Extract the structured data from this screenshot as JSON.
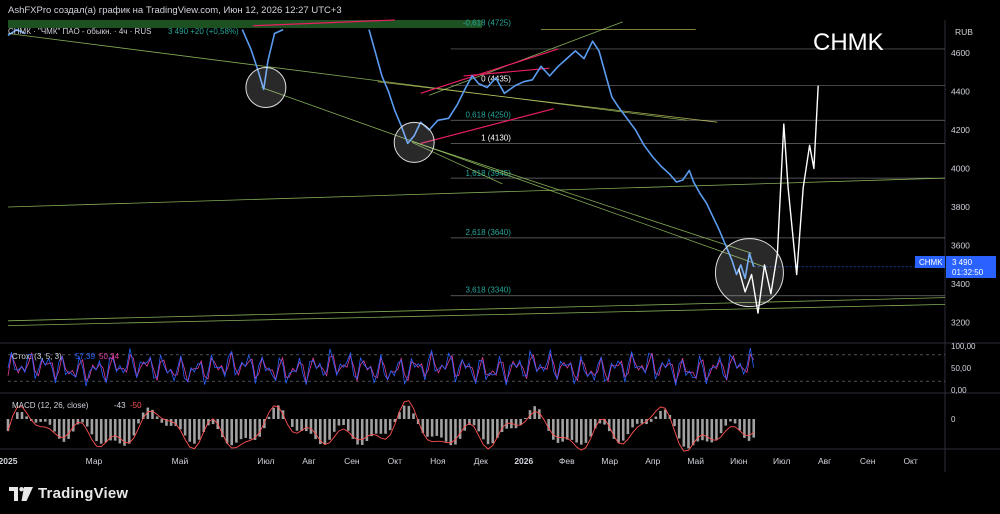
{
  "header": {
    "attribution": "AshFXPro создал(а) график на TradingView.com, Июн 12, 2026 12:27 UTC+3"
  },
  "symbol_bar": {
    "text": "СНМК · \"ЧМК\" ПАО - обыкн. · 4ч · RUS",
    "last_values": "3 490 +20 (+0,58%)"
  },
  "ticker_watermark": "CHMK",
  "currency": "RUB",
  "price_tag": {
    "symbol": "CHMK",
    "price": "3 490",
    "countdown": "01:32:50",
    "color": "#2962ff"
  },
  "fib_labels": [
    {
      "label": "-0,618 (4725)",
      "value": 4725
    },
    {
      "label": "0 (4435)",
      "value": 4435
    },
    {
      "label": "0,618 (4250)",
      "value": 4250
    },
    {
      "label": "1 (4130)",
      "value": 4130
    },
    {
      "label": "1,618 (3945)",
      "value": 3945
    },
    {
      "label": "2,618 (3640)",
      "value": 3640
    },
    {
      "label": "3,618 (3340)",
      "value": 3340
    }
  ],
  "oscillators": {
    "stoch_title": "Стох. (3, 5, 3)",
    "stoch_k": "57,39",
    "stoch_d": "50,34",
    "stoch_axis": [
      "100,00",
      "50,00",
      "0,00"
    ],
    "macd_title": "MACD (12, 26, close)",
    "macd_v1": "-43",
    "macd_v2": "-50",
    "macd_axis": [
      "0"
    ]
  },
  "branding": {
    "logo_text": "TradingView"
  },
  "colors": {
    "price_line": "#5b9cf0",
    "stoch_k": "#2962ff",
    "stoch_d": "#e040a0",
    "macd_line": "#ff5252",
    "macd_hist": "#bdbdbd",
    "fib_label": "#26a69a",
    "trendline": "#9ccc65",
    "channel": "#e91e63",
    "top_band": "#2e7d32"
  },
  "chart_data": {
    "type": "line",
    "title": "СНМК · \"ЧМК\" ПАО - обыкн. · 4ч · RUS",
    "ylabel": "RUB",
    "ylim": [
      3100,
      4770
    ],
    "y_ticks": [
      3200,
      3400,
      3600,
      3800,
      4000,
      4200,
      4400,
      4600
    ],
    "x_ticks": [
      "2025",
      "Мар",
      "Май",
      "Июл",
      "Авг",
      "Сен",
      "Окт",
      "Ноя",
      "Дек",
      "2026",
      "Фев",
      "Мар",
      "Апр",
      "Май",
      "Июн",
      "Июл",
      "Авг",
      "Сен",
      "Окт"
    ],
    "x_tick_month_index": [
      0,
      2,
      4,
      6,
      7,
      8,
      9,
      10,
      11,
      12,
      13,
      14,
      15,
      16,
      17,
      18,
      19,
      20,
      21
    ],
    "x_range_months": [
      0,
      21.8
    ],
    "series": [
      {
        "name": "CHMK",
        "points": [
          [
            0.0,
            4690
          ],
          [
            0.2,
            4720
          ],
          [
            0.4,
            4700
          ],
          [
            5.45,
            4720
          ],
          [
            5.65,
            4620
          ],
          [
            5.8,
            4520
          ],
          [
            5.95,
            4410
          ],
          [
            6.05,
            4560
          ],
          [
            6.2,
            4700
          ],
          [
            6.4,
            4720
          ],
          [
            8.4,
            4720
          ],
          [
            8.55,
            4600
          ],
          [
            8.7,
            4480
          ],
          [
            8.85,
            4400
          ],
          [
            9.0,
            4300
          ],
          [
            9.15,
            4220
          ],
          [
            9.3,
            4130
          ],
          [
            9.45,
            4170
          ],
          [
            9.6,
            4240
          ],
          [
            9.8,
            4200
          ],
          [
            10.0,
            4250
          ],
          [
            10.25,
            4260
          ],
          [
            10.45,
            4330
          ],
          [
            10.65,
            4420
          ],
          [
            10.8,
            4480
          ],
          [
            10.95,
            4440
          ],
          [
            11.15,
            4420
          ],
          [
            11.35,
            4470
          ],
          [
            11.55,
            4390
          ],
          [
            11.8,
            4430
          ],
          [
            12.0,
            4450
          ],
          [
            12.2,
            4460
          ],
          [
            12.4,
            4530
          ],
          [
            12.6,
            4480
          ],
          [
            12.8,
            4530
          ],
          [
            13.0,
            4570
          ],
          [
            13.2,
            4610
          ],
          [
            13.4,
            4570
          ],
          [
            13.6,
            4660
          ],
          [
            13.75,
            4610
          ],
          [
            13.9,
            4490
          ],
          [
            14.05,
            4370
          ],
          [
            14.2,
            4320
          ],
          [
            14.4,
            4260
          ],
          [
            14.6,
            4200
          ],
          [
            14.8,
            4120
          ],
          [
            15.0,
            4060
          ],
          [
            15.2,
            4010
          ],
          [
            15.4,
            3970
          ],
          [
            15.55,
            3930
          ],
          [
            15.7,
            3940
          ],
          [
            15.85,
            3990
          ],
          [
            15.95,
            3930
          ],
          [
            16.1,
            3870
          ],
          [
            16.25,
            3820
          ],
          [
            16.4,
            3750
          ],
          [
            16.55,
            3680
          ],
          [
            16.7,
            3600
          ],
          [
            16.85,
            3520
          ],
          [
            16.95,
            3450
          ],
          [
            17.05,
            3500
          ],
          [
            17.15,
            3430
          ],
          [
            17.25,
            3560
          ],
          [
            17.35,
            3490
          ]
        ]
      }
    ],
    "drawn_levels": [
      4620,
      4430,
      4250,
      4130,
      3950,
      3640,
      3340
    ],
    "stochastic": {
      "k": 57.39,
      "d": 50.34,
      "range": [
        0,
        100
      ]
    },
    "macd": {
      "macd": -43,
      "signal": -50
    }
  }
}
